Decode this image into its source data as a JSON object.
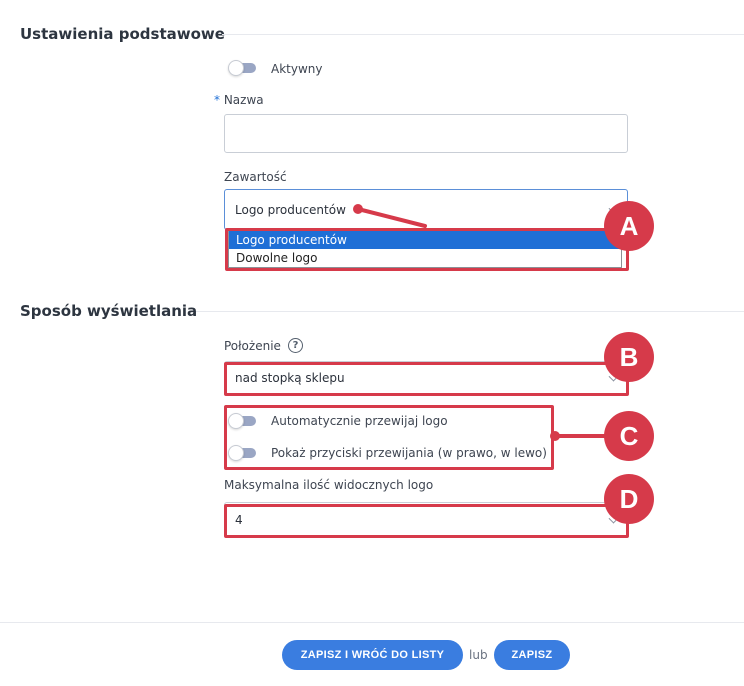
{
  "sections": {
    "basic": {
      "title": "Ustawienia podstawowe"
    },
    "display": {
      "title": "Sposób wyświetlania"
    }
  },
  "fields": {
    "active": {
      "label": "Aktywny"
    },
    "name": {
      "required_mark": "*",
      "label": "Nazwa",
      "value": ""
    },
    "content": {
      "label": "Zawartość",
      "selected": "Logo producentów",
      "options": [
        "Logo producentów",
        "Dowolne logo"
      ]
    },
    "position": {
      "label": "Położenie",
      "help_icon": "?",
      "selected": "nad stopką sklepu"
    },
    "auto_scroll": {
      "label": "Automatycznie przewijaj logo"
    },
    "scroll_buttons": {
      "label": "Pokaż przyciski przewijania (w prawo, w lewo)"
    },
    "max_logos": {
      "label": "Maksymalna ilość widocznych logo",
      "selected": "4"
    }
  },
  "annotations": {
    "a": "A",
    "b": "B",
    "c": "C",
    "d": "D",
    "color": "#d63a4a"
  },
  "footer": {
    "save_and_return": "ZAPISZ I WRÓĆ DO LISTY",
    "or": "lub",
    "save": "ZAPISZ"
  },
  "colors": {
    "accent": "#3a7de0",
    "selection": "#1f6fd6"
  }
}
